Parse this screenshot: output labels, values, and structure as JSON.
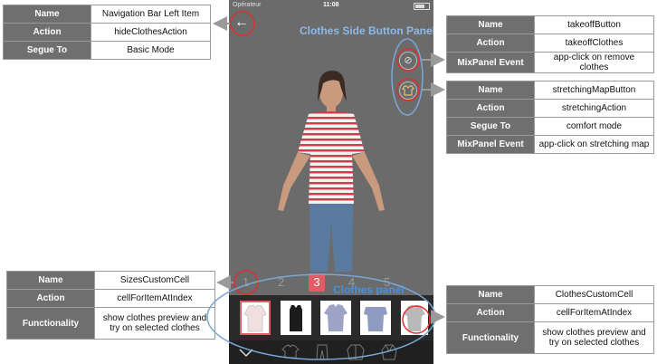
{
  "left_table": {
    "rows": [
      {
        "key": "Name",
        "value": "Navigation Bar Left Item"
      },
      {
        "key": "Action",
        "value": "hideClothesAction"
      },
      {
        "key": "Segue To",
        "value": "Basic Mode"
      }
    ]
  },
  "remove_table": {
    "rows": [
      {
        "key": "Name",
        "value": "takeoffButton"
      },
      {
        "key": "Action",
        "value": "takeoffClothes"
      },
      {
        "key": "MixPanel  Event",
        "value": "app-click on remove clothes"
      }
    ]
  },
  "stretch_table": {
    "rows": [
      {
        "key": "Name",
        "value": "stretchingMapButton"
      },
      {
        "key": "Action",
        "value": "stretchingAction"
      },
      {
        "key": "Segue To",
        "value": "comfort mode"
      },
      {
        "key": "MixPanel  Event",
        "value": "app-click on stretching map"
      }
    ]
  },
  "sizes_table": {
    "rows": [
      {
        "key": "Name",
        "value": "SizesCustomCell"
      },
      {
        "key": "Action",
        "value": "cellForItemAtIndex"
      },
      {
        "key": "Functionality",
        "value": "show clothes preview and try on selected clothes"
      }
    ]
  },
  "clothes_table": {
    "rows": [
      {
        "key": "Name",
        "value": "ClothesCustomCell"
      },
      {
        "key": "Action",
        "value": "cellForItemAtIndex"
      },
      {
        "key": "Functionality",
        "value": "show clothes preview and try on selected clothes"
      }
    ]
  },
  "phone": {
    "status": {
      "operator": "Opérateur",
      "time": "11:08"
    },
    "back_icon": "←",
    "side_panel_title": "Clothes Side Button Panel",
    "remove_icon": "⊘",
    "stretch_icon": "shirt-icon",
    "pages": [
      "1",
      "2",
      "3",
      "4",
      "5"
    ],
    "selected_page": "3",
    "clothes_panel_label": "Clothes panel",
    "colors": {
      "accent": "#e35b64",
      "annotation_blue": "#4a90d9",
      "annotation_red": "#d9322f"
    }
  }
}
